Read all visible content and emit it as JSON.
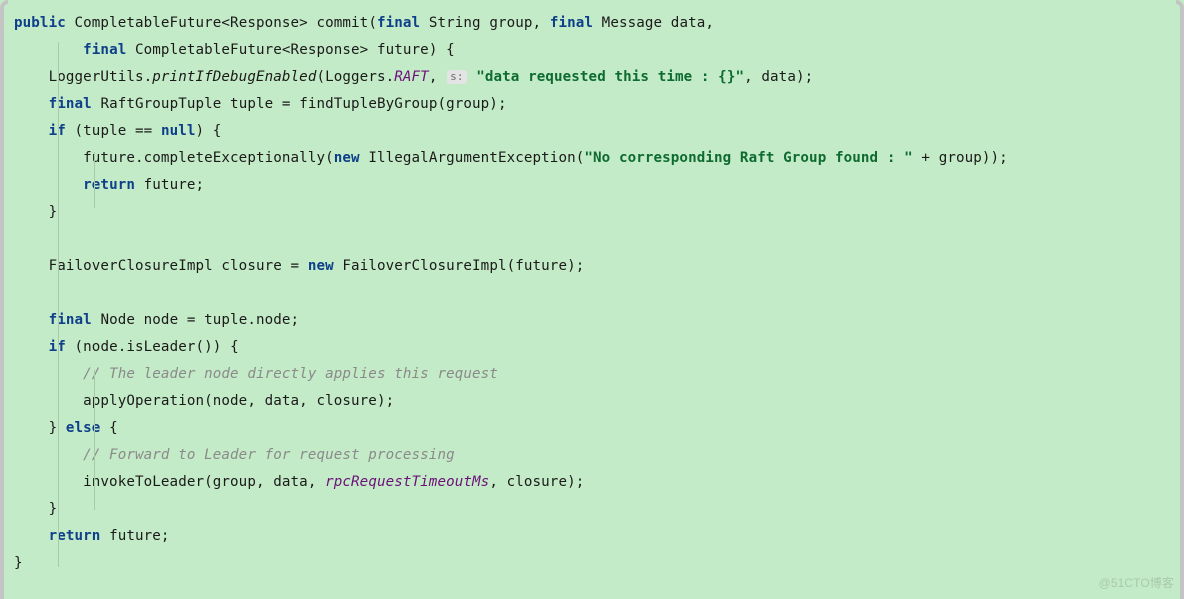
{
  "code": {
    "l1a": "public",
    "l1b": " CompletableFuture<Response> commit(",
    "l1c": "final",
    "l1d": " String group, ",
    "l1e": "final",
    "l1f": " Message data,",
    "l2a": "final",
    "l2b": " CompletableFuture<Response> future) {",
    "l3a": "    LoggerUtils.",
    "l3b": "printIfDebugEnabled",
    "l3c": "(Loggers.",
    "l3d": "RAFT",
    "l3e": ", ",
    "l3pill": "s:",
    "l3f": " \"data requested this time : {}\"",
    "l3g": ", data);",
    "l4a": "    ",
    "l4b": "final",
    "l4c": " RaftGroupTuple tuple = findTupleByGroup(group);",
    "l5a": "    ",
    "l5b": "if",
    "l5c": " (tuple == ",
    "l5d": "null",
    "l5e": ") {",
    "l6": "        future.completeExceptionally(",
    "l6b": "new",
    "l6c": " IllegalArgumentException(",
    "l6d": "\"No corresponding Raft Group found : \"",
    "l6e": " + group));",
    "l7a": "        ",
    "l7b": "return",
    "l7c": " future;",
    "l8": "    }",
    "l9": "",
    "l10a": "    FailoverClosureImpl closure = ",
    "l10b": "new",
    "l10c": " FailoverClosureImpl(future);",
    "l11": "",
    "l12a": "    ",
    "l12b": "final",
    "l12c": " Node node = tuple.node;",
    "l13a": "    ",
    "l13b": "if",
    "l13c": " (node.isLeader()) {",
    "l14": "        // The leader node directly applies this request",
    "l15": "        applyOperation(node, data, closure);",
    "l16a": "    } ",
    "l16b": "else",
    "l16c": " {",
    "l17": "        // Forward to Leader for request processing",
    "l18a": "        invokeToLeader(group, data, ",
    "l18b": "rpcRequestTimeoutMs",
    "l18c": ", closure);",
    "l19": "    }",
    "l20a": "    ",
    "l20b": "return",
    "l20c": " future;",
    "l21": "}"
  },
  "watermark": "@51CTO博客"
}
